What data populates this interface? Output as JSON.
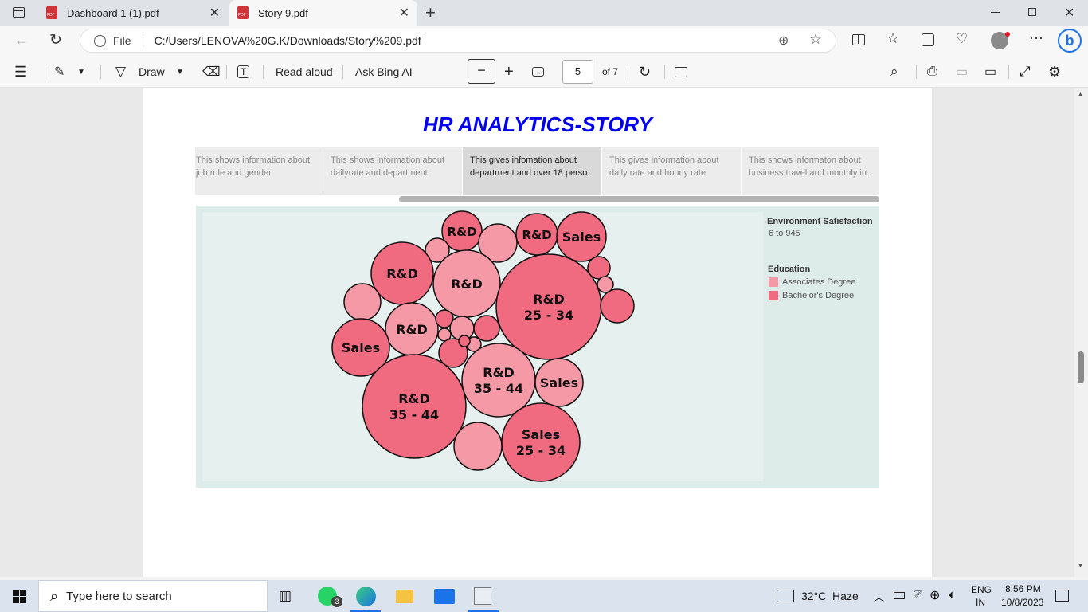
{
  "browser": {
    "tabs": [
      {
        "title": "Dashboard 1 (1).pdf",
        "active": false
      },
      {
        "title": "Story 9.pdf",
        "active": true
      }
    ],
    "file_label": "File",
    "url": "C:/Users/LENOVA%20G.K/Downloads/Story%209.pdf"
  },
  "toolbar": {
    "draw_label": "Draw",
    "read_aloud_label": "Read aloud",
    "ask_bing_label": "Ask Bing AI",
    "page_number": "5",
    "page_of": "of 7"
  },
  "story": {
    "title": "HR ANALYTICS-STORY",
    "title_color": "#0000ee",
    "tabs": [
      {
        "text": "This shows information about job role and gender"
      },
      {
        "text": "This shows information about dailyrate and department"
      },
      {
        "text": "This gives infomation about department and over 18 perso.."
      },
      {
        "text": "This gives information about daily rate and hourly rate"
      },
      {
        "text": "This shows informaton about business travel and monthly in.."
      }
    ],
    "active_tab": 2
  },
  "chart_data": {
    "type": "bubble",
    "bubbles": [
      {
        "label1": "R&D",
        "label2": "",
        "education": "Bachelor's Degree"
      },
      {
        "label1": "R&D",
        "label2": "",
        "education": "Bachelor's Degree"
      },
      {
        "label1": "Sales",
        "label2": "",
        "education": "Bachelor's Degree"
      },
      {
        "label1": "",
        "label2": "",
        "education": "Associates Degree"
      },
      {
        "label1": "",
        "label2": "",
        "education": "Associates Degree"
      },
      {
        "label1": "R&D",
        "label2": "",
        "education": "Bachelor's Degree"
      },
      {
        "label1": "R&D",
        "label2": "",
        "education": "Associates Degree"
      },
      {
        "label1": "R&D",
        "label2": "25 - 34",
        "education": "Bachelor's Degree"
      },
      {
        "label1": "",
        "label2": "",
        "education": "Bachelor's Degree"
      },
      {
        "label1": "",
        "label2": "",
        "education": "Associates Degree"
      },
      {
        "label1": "",
        "label2": "",
        "education": "Bachelor's Degree"
      },
      {
        "label1": "",
        "label2": "",
        "education": "Associates Degree"
      },
      {
        "label1": "R&D",
        "label2": "",
        "education": "Associates Degree"
      },
      {
        "label1": "Sales",
        "label2": "",
        "education": "Bachelor's Degree"
      },
      {
        "label1": "",
        "label2": "",
        "education": "Bachelor's Degree"
      },
      {
        "label1": "",
        "label2": "",
        "education": "Associates Degree"
      },
      {
        "label1": "",
        "label2": "",
        "education": "Bachelor's Degree"
      },
      {
        "label1": "",
        "label2": "",
        "education": "Associates Degree"
      },
      {
        "label1": "",
        "label2": "",
        "education": "Bachelor's Degree"
      },
      {
        "label1": "",
        "label2": "",
        "education": "Associates Degree"
      },
      {
        "label1": "",
        "label2": "",
        "education": "Bachelor's Degree"
      },
      {
        "label1": "R&D",
        "label2": "35 - 44",
        "education": "Associates Degree"
      },
      {
        "label1": "Sales",
        "label2": "",
        "education": "Associates Degree"
      },
      {
        "label1": "R&D",
        "label2": "35 - 44",
        "education": "Bachelor's Degree"
      },
      {
        "label1": "",
        "label2": "",
        "education": "Associates Degree"
      },
      {
        "label1": "Sales",
        "label2": "25 - 34",
        "education": "Bachelor's Degree"
      }
    ],
    "legend": {
      "size_title": "Environment Satisfaction",
      "size_range": "6 to 945",
      "color_title": "Education",
      "items": [
        {
          "label": "Associates Degree",
          "color": "#f599a6"
        },
        {
          "label": "Bachelor's Degree",
          "color": "#f06a80"
        }
      ]
    }
  },
  "taskbar": {
    "search_placeholder": "Type here to search",
    "whatsapp_badge": "3",
    "weather": "32°C  Haze",
    "lang1": "ENG",
    "lang2": "IN",
    "time": "8:56 PM",
    "date": "10/8/2023"
  }
}
